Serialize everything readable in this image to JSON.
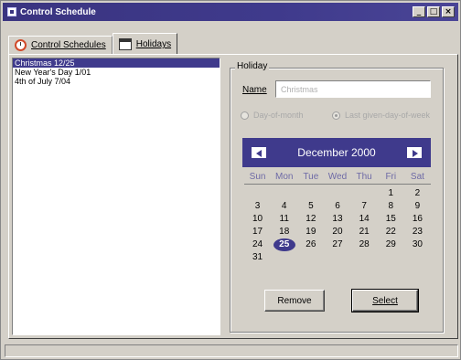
{
  "window": {
    "title": "Control Schedule",
    "controls": {
      "minimize": "_",
      "maximize": "□",
      "close": "×"
    }
  },
  "tabs": [
    {
      "label": "Control Schedules",
      "icon": "clock-icon",
      "active": false
    },
    {
      "label": "Holidays",
      "icon": "calendar-icon",
      "active": true
    }
  ],
  "holiday_list": {
    "items": [
      {
        "label": "Christmas  12/25",
        "selected": true
      },
      {
        "label": "New Year's Day  1/01",
        "selected": false
      },
      {
        "label": "4th of July  7/04",
        "selected": false
      }
    ]
  },
  "holiday_group": {
    "label": "Holiday",
    "name_label": "Name",
    "name_value": "Christmas",
    "radio_options": [
      {
        "label": "Day-of-month",
        "checked": false
      },
      {
        "label": "Last given-day-of-week",
        "checked": true
      }
    ]
  },
  "calendar": {
    "month_label": "December 2000",
    "weekdays": [
      "Sun",
      "Mon",
      "Tue",
      "Wed",
      "Thu",
      "Fri",
      "Sat"
    ],
    "days": [
      "",
      "",
      "",
      "",
      "",
      "1",
      "2",
      "3",
      "4",
      "5",
      "6",
      "7",
      "8",
      "9",
      "10",
      "11",
      "12",
      "13",
      "14",
      "15",
      "16",
      "17",
      "18",
      "19",
      "20",
      "21",
      "22",
      "23",
      "24",
      "25",
      "26",
      "27",
      "28",
      "29",
      "30",
      "31",
      "",
      "",
      "",
      "",
      "",
      ""
    ],
    "selected_day": "25",
    "accent": "#3f3a8c"
  },
  "buttons": {
    "remove": "Remove",
    "select": "Select"
  }
}
